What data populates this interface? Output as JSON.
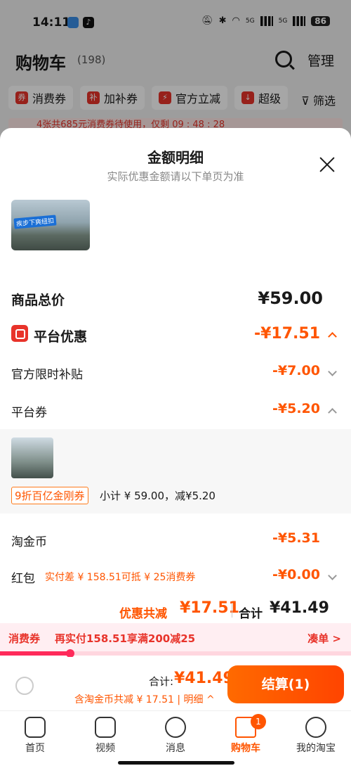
{
  "status_bar": {
    "time": "14:11",
    "battery": "86",
    "net1": "5G",
    "net2": "5G"
  },
  "cart": {
    "title": "购物车",
    "count": "(198)",
    "manage": "管理",
    "chips": [
      "消费券",
      "加补券",
      "官方立减",
      "超级"
    ],
    "filter": "筛选",
    "strip_text": "4张共685元消费券待使用，仅剩 09 : 48 : 28"
  },
  "sheet": {
    "title": "金额明细",
    "subtitle": "实际优惠金额请以下单页为准",
    "product_tag": "疾步下爽纽扣",
    "total_label": "商品总价",
    "total_value": "¥59.00",
    "platform_label": "平台优惠",
    "platform_value": "-¥17.51",
    "official_label": "官方限时补贴",
    "official_value": "-¥7.00",
    "coupon_label": "平台券",
    "coupon_value": "-¥5.20",
    "coupon_tag": "9折百亿金刚券",
    "coupon_sub": "小计 ¥ 59.00，减¥5.20",
    "coin_label": "淘金币",
    "coin_value": "-¥5.31",
    "hongbao_label": "红包",
    "hongbao_note": "实付差 ¥ 158.51可抵 ¥ 25消费券",
    "hongbao_value": "-¥0.00",
    "summary_label": "优惠共减",
    "summary_amount": "¥17.51",
    "summary_total_label": "合计",
    "summary_total": "¥41.49"
  },
  "promo": {
    "tag": "消费券",
    "text": "再实付158.51享满200减25",
    "action": "凑单 >",
    "progress_fraction": 0.2
  },
  "checkout": {
    "total_label": "合计:",
    "total": "¥41.49",
    "sub": "含淘金币共减 ¥ 17.51 | 明细 ^",
    "button": "结算(1)"
  },
  "tabs": [
    "首页",
    "视频",
    "消息",
    "购物车",
    "我的淘宝"
  ],
  "cart_badge": "1",
  "colors": {
    "accent": "#ff5500",
    "red": "#e8332a",
    "pink": "#ff2a5a"
  }
}
